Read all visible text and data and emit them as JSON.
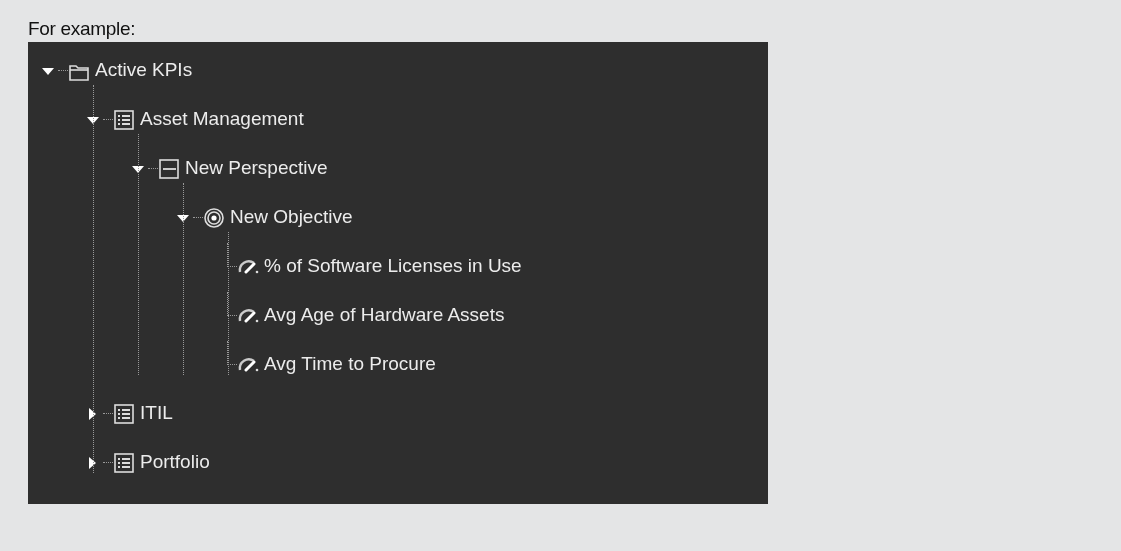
{
  "caption": "For example:",
  "tree": [
    {
      "label": "Active KPIs",
      "kind": "folder",
      "expanded": true,
      "children": [
        {
          "label": "Asset Management",
          "kind": "category",
          "expanded": true,
          "children": [
            {
              "label": "New Perspective",
              "kind": "perspective",
              "expanded": true,
              "children": [
                {
                  "label": "New Objective",
                  "kind": "objective",
                  "expanded": true,
                  "children": [
                    {
                      "label": "% of Software Licenses in Use",
                      "kind": "kpi"
                    },
                    {
                      "label": "Avg Age of Hardware Assets",
                      "kind": "kpi"
                    },
                    {
                      "label": "Avg Time to Procure",
                      "kind": "kpi"
                    }
                  ]
                }
              ]
            }
          ]
        },
        {
          "label": "ITIL",
          "kind": "category",
          "expanded": false
        },
        {
          "label": "Portfolio",
          "kind": "category",
          "expanded": false
        }
      ]
    }
  ]
}
